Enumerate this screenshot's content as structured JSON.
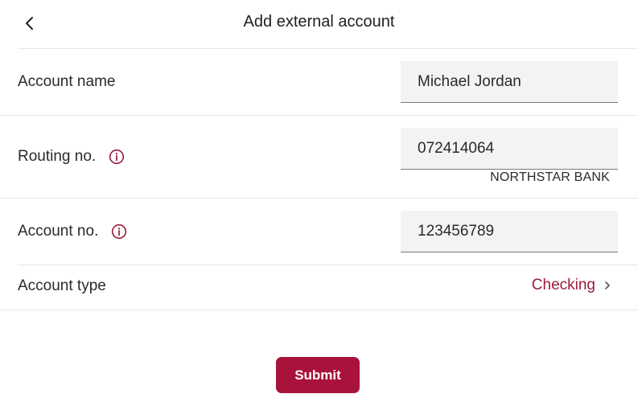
{
  "header": {
    "title": "Add external account",
    "back_icon": "chevron-left-icon"
  },
  "form": {
    "account_name": {
      "label": "Account name",
      "value": "Michael Jordan"
    },
    "routing_no": {
      "label": "Routing no.",
      "value": "072414064",
      "bank_name": "NORTHSTAR BANK",
      "info_icon": "info-circle-icon"
    },
    "account_no": {
      "label": "Account no.",
      "value": "123456789",
      "info_icon": "info-circle-icon"
    },
    "account_type": {
      "label": "Account type",
      "value": "Checking",
      "chevron_icon": "chevron-right-icon"
    }
  },
  "actions": {
    "submit_label": "Submit"
  },
  "colors": {
    "accent": "#a9123a",
    "accent_text": "#9b1b3d",
    "field_bg": "#f3f3f3",
    "divider": "#e6e6e6"
  }
}
